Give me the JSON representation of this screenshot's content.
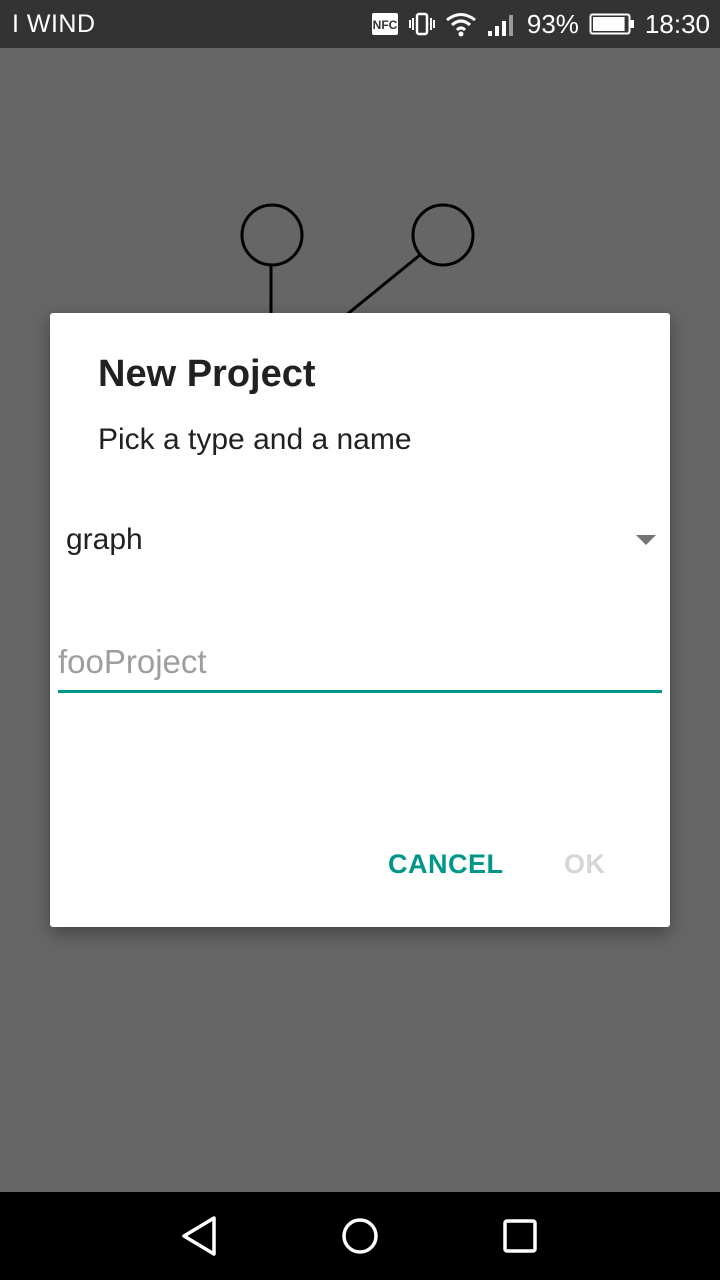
{
  "status_bar": {
    "carrier": "I WIND",
    "nfc_label": "NFC",
    "battery_percent": "93%",
    "battery_level": 0.93,
    "time": "18:30"
  },
  "dialog": {
    "title": "New Project",
    "message": "Pick a type and a name",
    "type_spinner": {
      "selected": "graph"
    },
    "name_input": {
      "value": "",
      "placeholder": "fooProject"
    },
    "buttons": {
      "cancel_label": "CANCEL",
      "ok_label": "OK"
    },
    "accent_color": "#009688"
  },
  "nav_bar": {
    "back_icon": "triangle-back-icon",
    "home_icon": "circle-home-icon",
    "recents_icon": "square-recents-icon"
  }
}
